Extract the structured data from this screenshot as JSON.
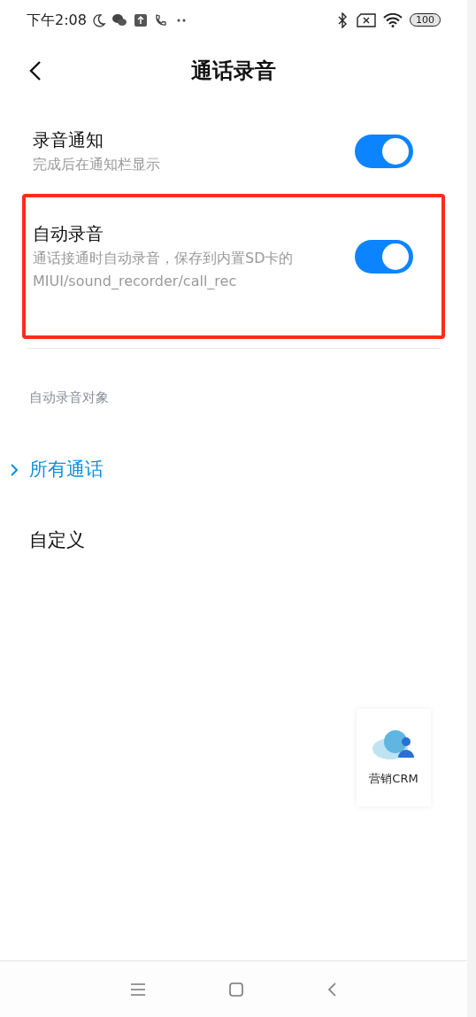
{
  "status_bar": {
    "time": "下午2:08",
    "battery": "100"
  },
  "header": {
    "title": "通话录音"
  },
  "settings": [
    {
      "title": "录音通知",
      "subtitle": "完成后在通知栏显示",
      "on": true,
      "highlighted": false
    },
    {
      "title": "自动录音",
      "subtitle": "通话接通时自动录音，保存到内置SD卡的MIUI/sound_recorder/call_rec",
      "on": true,
      "highlighted": true
    }
  ],
  "section": {
    "title": "自动录音对象",
    "options": [
      {
        "label": "所有通话",
        "selected": true
      },
      {
        "label": "自定义",
        "selected": false
      }
    ]
  },
  "floating_widget": {
    "label": "营销CRM"
  }
}
